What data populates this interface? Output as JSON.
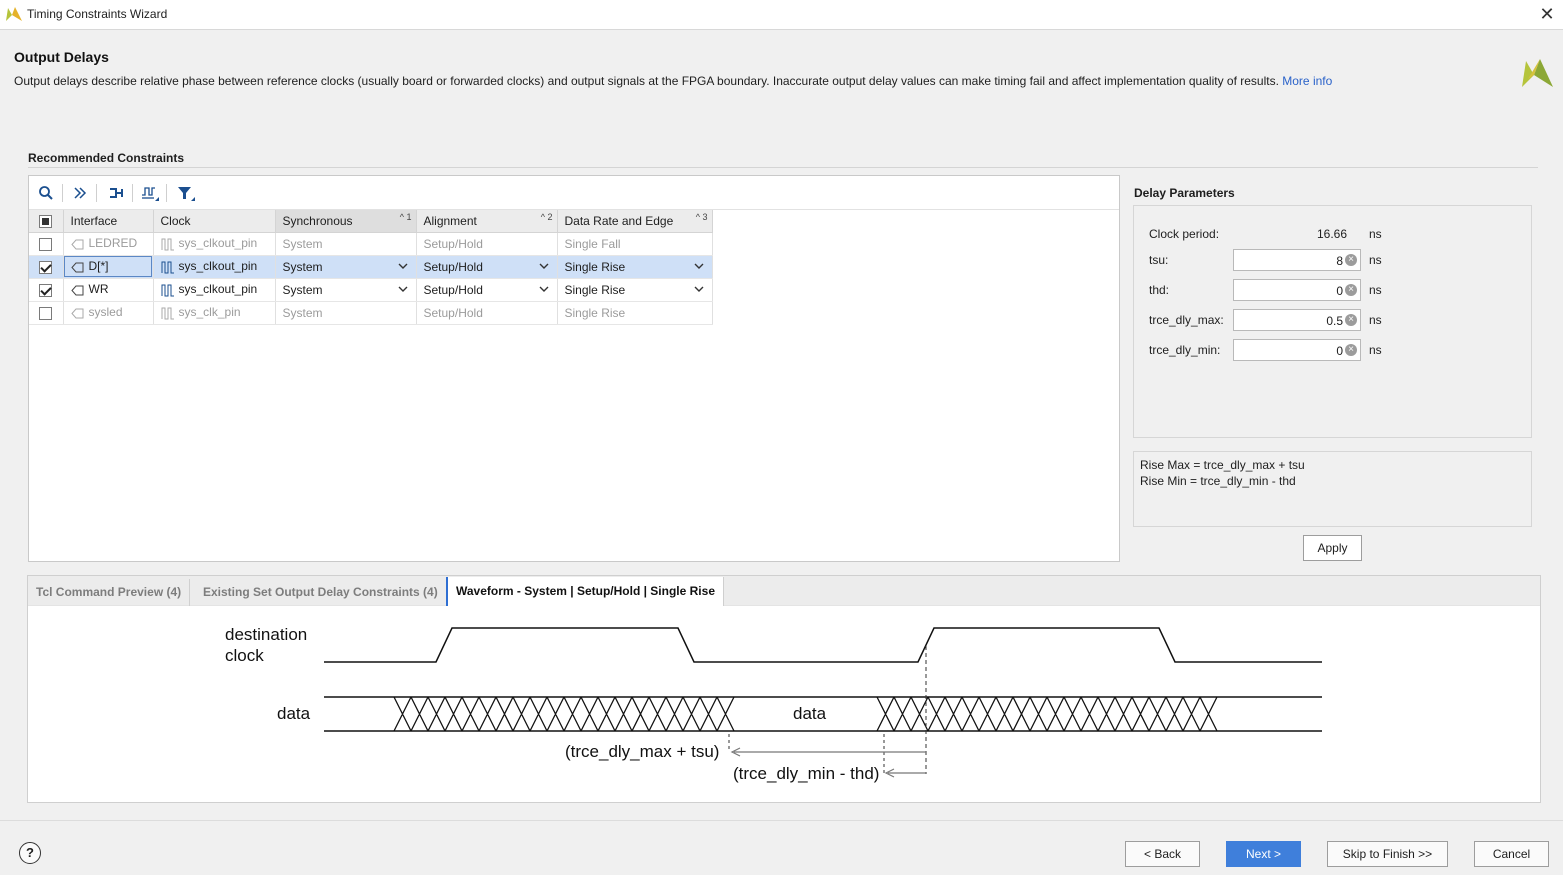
{
  "window": {
    "title": "Timing Constraints Wizard"
  },
  "header": {
    "title": "Output Delays",
    "description": "Output delays describe relative phase between reference clocks (usually board or forwarded clocks) and output signals at the FPGA boundary. Inaccurate output delay values can make timing fail and affect implementation quality of results.",
    "more_info": "More info"
  },
  "recommended": {
    "label": "Recommended Constraints",
    "toolbar": [
      "search-icon",
      "collapse-icon",
      "fit-icon",
      "waveform-icon",
      "filter-icon"
    ],
    "columns": [
      {
        "label": "Interface",
        "sort": ""
      },
      {
        "label": "Clock",
        "sort": ""
      },
      {
        "label": "Synchronous",
        "sort": "1"
      },
      {
        "label": "Alignment",
        "sort": "2"
      },
      {
        "label": "Data Rate and Edge",
        "sort": "3"
      }
    ],
    "rows": [
      {
        "interface": "LEDRED",
        "clock": "sys_clkout_pin",
        "synchronous": "System",
        "alignment": "Setup/Hold",
        "edge": "Single Fall"
      },
      {
        "interface": "D[*]",
        "clock": "sys_clkout_pin",
        "synchronous": "System",
        "alignment": "Setup/Hold",
        "edge": "Single Rise"
      },
      {
        "interface": "WR",
        "clock": "sys_clkout_pin",
        "synchronous": "System",
        "alignment": "Setup/Hold",
        "edge": "Single Rise"
      },
      {
        "interface": "sysled",
        "clock": "sys_clk_pin",
        "synchronous": "System",
        "alignment": "Setup/Hold",
        "edge": "Single Rise"
      }
    ]
  },
  "params": {
    "label": "Delay Parameters",
    "clock_period_label": "Clock period:",
    "clock_period_value": "16.66",
    "unit": "ns",
    "tsu_label": "tsu:",
    "tsu_value": "8",
    "thd_label": "thd:",
    "thd_value": "0",
    "max_label": "trce_dly_max:",
    "max_value": "0.5",
    "min_label": "trce_dly_min:",
    "min_value": "0",
    "formula_line1": "Rise Max = trce_dly_max + tsu",
    "formula_line2": "Rise Min = trce_dly_min - thd",
    "apply": "Apply"
  },
  "tabs": {
    "tcl": "Tcl Command Preview (4)",
    "existing": "Existing Set Output Delay Constraints (4)",
    "waveform": "Waveform - System | Setup/Hold | Single Rise"
  },
  "waveform": {
    "clock_label_1": "destination",
    "clock_label_2": "clock",
    "data_label": "data",
    "data_window": "data",
    "max_annot": "(trce_dly_max + tsu)",
    "min_annot": "(trce_dly_min - thd)"
  },
  "footer": {
    "help": "?",
    "back": "< Back",
    "next": "Next >",
    "skip": "Skip to Finish >>",
    "cancel": "Cancel"
  },
  "colors": {
    "accent": "#3f7fdb",
    "selection": "#cfe0f7",
    "link": "#2a62c9"
  }
}
